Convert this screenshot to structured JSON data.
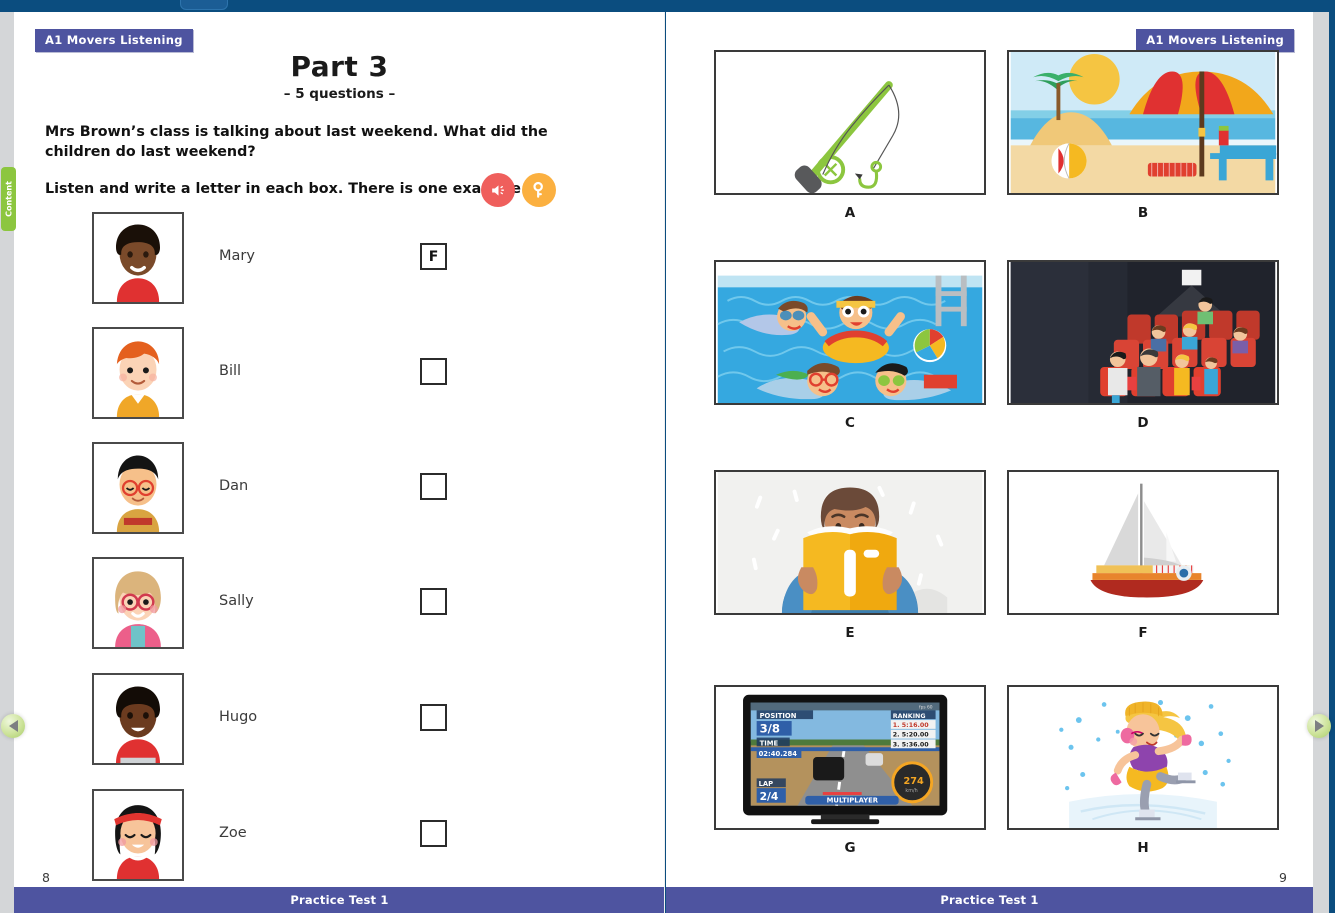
{
  "app": {
    "background_color": "#0b4d7f",
    "accent_color": "#4e54a0"
  },
  "sidebar": {
    "content_tab_label": "Content"
  },
  "nav": {
    "prev_label": "◀",
    "next_label": "▶"
  },
  "left_page": {
    "badge": "A1 Movers Listening",
    "title": "Part 3",
    "subtitle": "– 5 questions –",
    "instruction_1": "Mrs Brown’s class is talking about last weekend. What did the children do last weekend?",
    "instruction_2": "Listen and write a letter in each box. There is one example.",
    "audio_icon": "speaker-icon",
    "key_icon": "key-icon",
    "questions": [
      {
        "name": "Mary",
        "answer": "F",
        "avatar": "girl-dark-skin-black-afro-red-top"
      },
      {
        "name": "Bill",
        "answer": "",
        "avatar": "boy-ginger-hair-orange-shirt"
      },
      {
        "name": "Dan",
        "answer": "",
        "avatar": "boy-black-hair-red-glasses"
      },
      {
        "name": "Sally",
        "answer": "",
        "avatar": "girl-blonde-red-glasses-pink-cardigan"
      },
      {
        "name": "Hugo",
        "answer": "",
        "avatar": "boy-dark-skin-black-hair-red-shirt"
      },
      {
        "name": "Zoe",
        "answer": "",
        "avatar": "girl-black-bob-red-headband-red-dress"
      }
    ],
    "page_number": "8",
    "footer": "Practice Test 1"
  },
  "right_page": {
    "badge": "A1 Movers Listening",
    "pictures": [
      {
        "label": "A",
        "description": "fishing-rod"
      },
      {
        "label": "B",
        "description": "beach-umbrella-sun-lounger"
      },
      {
        "label": "C",
        "description": "children-swimming-pool"
      },
      {
        "label": "D",
        "description": "cinema-audience"
      },
      {
        "label": "E",
        "description": "woman-reading-book"
      },
      {
        "label": "F",
        "description": "sailing-boat"
      },
      {
        "label": "G",
        "description": "racing-video-game-tv"
      },
      {
        "label": "H",
        "description": "girl-ice-skating"
      }
    ],
    "page_number": "9",
    "footer": "Practice Test 1"
  }
}
